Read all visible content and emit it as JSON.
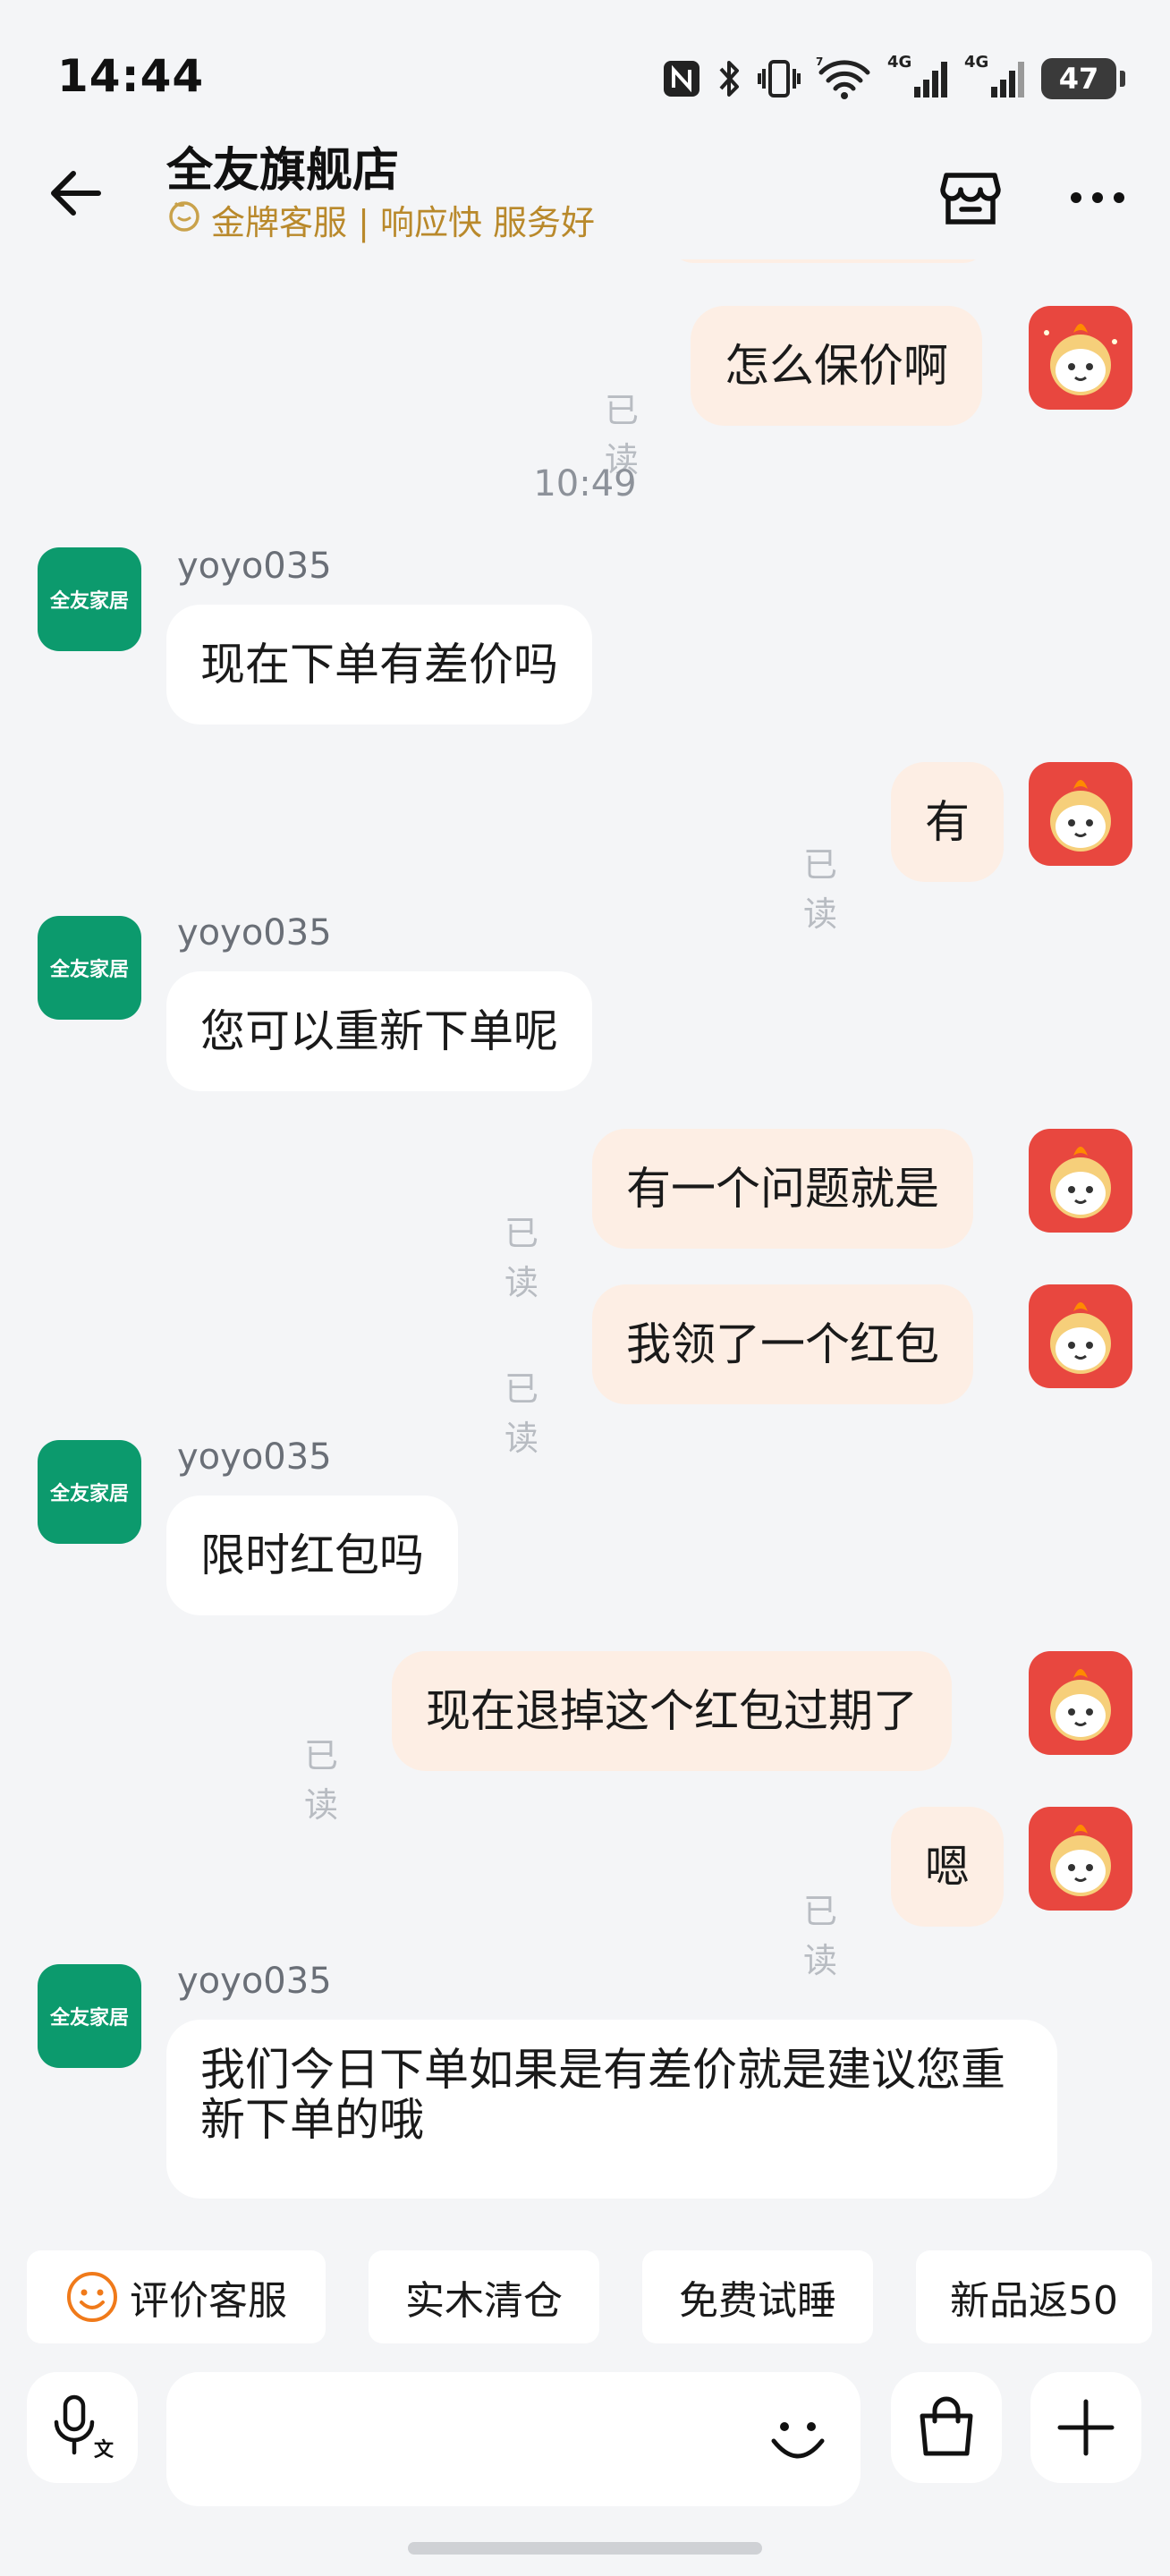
{
  "status_bar": {
    "time": "14:44",
    "battery": "47",
    "icons": [
      "nfc-icon",
      "bluetooth-icon",
      "vibrate-icon",
      "wifi-icon",
      "signal-4g-icon",
      "signal-4g-icon"
    ],
    "network_labels": [
      "4G",
      "4G"
    ]
  },
  "header": {
    "store_name": "全友旗舰店",
    "subtitle": "金牌客服 | 响应快 服务好",
    "subtitle_color": "#b9892b"
  },
  "chat": {
    "messages": [
      {
        "dir": "out",
        "text": "怎么保价啊",
        "read": "已读"
      },
      {
        "time": "10:49"
      },
      {
        "dir": "in",
        "sender": "yoyo035",
        "avatar": "全友家居",
        "text": "现在下单有差价吗"
      },
      {
        "dir": "out",
        "text": "有",
        "read": "已读"
      },
      {
        "dir": "in",
        "sender": "yoyo035",
        "avatar": "全友家居",
        "text": "您可以重新下单呢"
      },
      {
        "dir": "out",
        "text": "有一个问题就是",
        "read": "已读"
      },
      {
        "dir": "out",
        "text": "我领了一个红包",
        "read": "已读"
      },
      {
        "dir": "in",
        "sender": "yoyo035",
        "avatar": "全友家居",
        "text": "限时红包吗"
      },
      {
        "dir": "out",
        "text": "现在退掉这个红包过期了",
        "read": "已读"
      },
      {
        "dir": "out",
        "text": "嗯",
        "read": "已读"
      },
      {
        "dir": "in",
        "sender": "yoyo035",
        "avatar": "全友家居",
        "text": "我们今日下单如果是有差价就是建议您重新下单的哦"
      }
    ]
  },
  "quick_actions": [
    {
      "label": "评价客服",
      "icon": "smile-icon"
    },
    {
      "label": "实木清仓"
    },
    {
      "label": "免费试睡"
    },
    {
      "label": "新品返50"
    }
  ],
  "input": {
    "placeholder": "",
    "voice_icon": "voice-translate-icon",
    "emoji_icon": "emoji-icon",
    "bag_icon": "shopping-bag-icon",
    "plus_icon": "plus-icon"
  },
  "colors": {
    "accent_brand": "#0c9a6d",
    "outgoing_bubble": "#fdeee4",
    "incoming_bubble": "#ffffff",
    "background": "#f4f5f7"
  }
}
